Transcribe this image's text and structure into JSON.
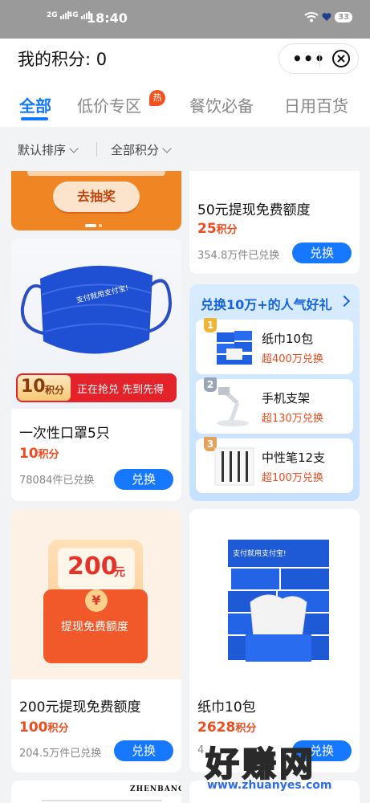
{
  "status_bar": {
    "net1": "2G",
    "net2": "4G",
    "time": "18:40",
    "battery": "33"
  },
  "header": {
    "title": "我的积分: 0",
    "more_icon": "more-icon",
    "close_icon": "close-icon"
  },
  "tabs": [
    {
      "label": "全部",
      "active": true
    },
    {
      "label": "低价专区",
      "badge": "热"
    },
    {
      "label": "餐饮必备"
    },
    {
      "label": "日用百货"
    }
  ],
  "filters": {
    "sort": "默认排序",
    "points": "全部积分"
  },
  "lottery": {
    "button": "去抽奖"
  },
  "cards": {
    "cash50": {
      "title": "50元提现免费额度",
      "points": "25",
      "unit": "积分",
      "sold": "354.8万件已兑换",
      "button": "兑换"
    },
    "mask": {
      "title": "一次性口罩5只",
      "points": "10",
      "unit": "积分",
      "sold": "78084件已兑换",
      "button": "兑换",
      "img_points": "10",
      "img_unit": "积分",
      "img_tag": "正在抢兑 先到先得",
      "img_print": "支付就用支付宝!"
    },
    "cash200": {
      "title": "200元提现免费额度",
      "points": "100",
      "unit": "积分",
      "sold": "204.5万件已兑换",
      "button": "兑换",
      "img_amount": "200",
      "img_yuan": "元",
      "img_symbol": "¥",
      "img_label": "提现免费额度"
    },
    "tissue": {
      "title": "纸巾10包",
      "points": "2628",
      "unit": "积分",
      "sold_partial": "4",
      "button": "兑换",
      "img_print": "支付就用支付宝!"
    }
  },
  "popular": {
    "title": "兑换10万+的人气好礼",
    "items": [
      {
        "rank": "1",
        "name": "纸巾10包",
        "sub": "超400万兑换"
      },
      {
        "rank": "2",
        "name": "手机支架",
        "sub": "超130万兑换"
      },
      {
        "rank": "3",
        "name": "中性笔12支",
        "sub": "超100万兑换"
      }
    ]
  },
  "bottom_peek": {
    "brand": "ZHENBANG"
  },
  "watermark": {
    "text": "好赚网",
    "url": "www.zhuanyes.com"
  },
  "colors": {
    "accent": "#1677ff",
    "points": "#ee4c1e",
    "orange": "#f08524"
  }
}
